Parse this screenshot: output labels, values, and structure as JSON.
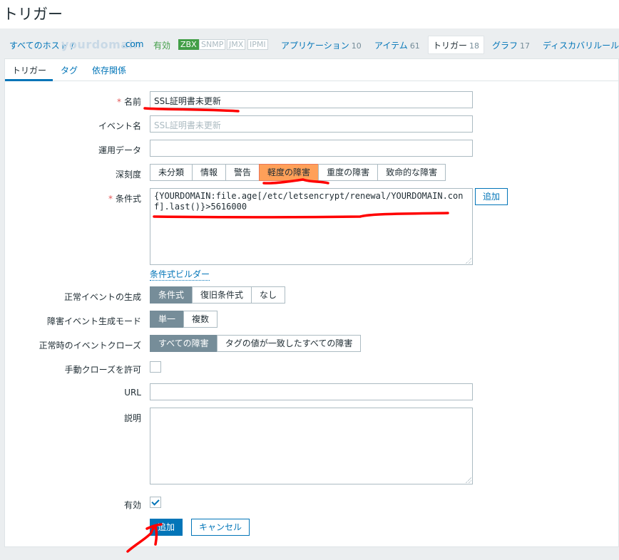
{
  "page": {
    "title": "トリガー"
  },
  "nav": {
    "host_link": "すべてのホスト /",
    "host_watermark": "yourdomain",
    "host_suffix": ".com",
    "enabled": "有効",
    "badges": [
      "ZBX",
      "SNMP",
      "JMX",
      "IPMI"
    ],
    "tabs": [
      {
        "label": "アプリケーション",
        "count": "10"
      },
      {
        "label": "アイテム",
        "count": "61"
      },
      {
        "label": "トリガー",
        "count": "18"
      },
      {
        "label": "グラフ",
        "count": "17"
      },
      {
        "label": "ディスカバリルール",
        "count": ""
      }
    ]
  },
  "subtabs": [
    "トリガー",
    "タグ",
    "依存関係"
  ],
  "form": {
    "name_label": "名前",
    "name_value": "SSL証明書未更新",
    "event_name_label": "イベント名",
    "event_name_placeholder": "SSL証明書未更新",
    "opdata_label": "運用データ",
    "opdata_value": "",
    "severity_label": "深刻度",
    "severity_options": [
      "未分類",
      "情報",
      "警告",
      "軽度の障害",
      "重度の障害",
      "致命的な障害"
    ],
    "severity_selected": "軽度の障害",
    "expression_label": "条件式",
    "expression_value": "{YOURDOMAIN:file.age[/etc/letsencrypt/renewal/YOURDOMAIN.conf].last()}>5616000",
    "expression_add": "追加",
    "expression_builder": "条件式ビルダー",
    "ok_event_label": "正常イベントの生成",
    "ok_event_options": [
      "条件式",
      "復旧条件式",
      "なし"
    ],
    "ok_event_selected": "条件式",
    "problem_mode_label": "障害イベント生成モード",
    "problem_mode_options": [
      "単一",
      "複数"
    ],
    "problem_mode_selected": "単一",
    "ok_close_label": "正常時のイベントクローズ",
    "ok_close_options": [
      "すべての障害",
      "タグの値が一致したすべての障害"
    ],
    "ok_close_selected": "すべての障害",
    "manual_close_label": "手動クローズを許可",
    "url_label": "URL",
    "url_value": "",
    "description_label": "説明",
    "description_value": "",
    "enabled_label": "有効",
    "add_button": "追加",
    "cancel_button": "キャンセル"
  },
  "colors": {
    "accent": "#0275b8",
    "selected_severity": "#ffa059",
    "annotation": "#ff0000"
  }
}
